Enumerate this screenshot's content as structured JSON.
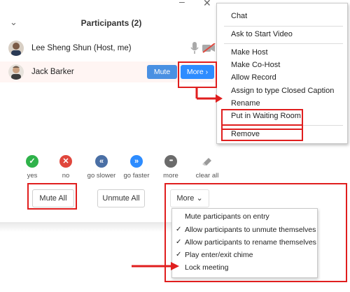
{
  "window": {
    "title": "Participants (2)",
    "minimize_glyph": "–",
    "close_glyph": "✕",
    "collapse_glyph": "⌄"
  },
  "participants": [
    {
      "name": "Lee Sheng Shun (Host, me)",
      "mic_icon": "mic-icon",
      "video_icon": "video-off-icon"
    },
    {
      "name": "Jack Barker",
      "mute_label": "Mute",
      "more_label": "More ›"
    }
  ],
  "reactions": [
    {
      "label": "yes",
      "glyph": "✓",
      "color": "#2fb24a"
    },
    {
      "label": "no",
      "glyph": "✕",
      "color": "#e0463c"
    },
    {
      "label": "go slower",
      "glyph": "«",
      "color": "#4a6fa5"
    },
    {
      "label": "go faster",
      "glyph": "»",
      "color": "#2d8cff"
    },
    {
      "label": "more",
      "glyph": "•••",
      "color": "#6b6b6b"
    },
    {
      "label": "clear all",
      "glyph": "",
      "color": "#9a9a9a"
    }
  ],
  "actions": {
    "mute_all": "Mute All",
    "unmute_all": "Unmute All",
    "more": "More ⌄"
  },
  "participant_menu": [
    "Chat",
    "Ask to Start Video",
    "Make Host",
    "Make Co-Host",
    "Allow Record",
    "Assign to type Closed Caption",
    "Rename",
    "Put in Waiting Room",
    "Remove"
  ],
  "more_menu": [
    {
      "label": "Mute participants on entry",
      "checked": false
    },
    {
      "label": "Allow participants to unmute themselves",
      "checked": true
    },
    {
      "label": "Allow participants to rename themselves",
      "checked": true
    },
    {
      "label": "Play enter/exit chime",
      "checked": true
    },
    {
      "label": "Lock meeting",
      "checked": false
    }
  ],
  "check_glyph": "✓",
  "highlight_color": "#e01e1e"
}
